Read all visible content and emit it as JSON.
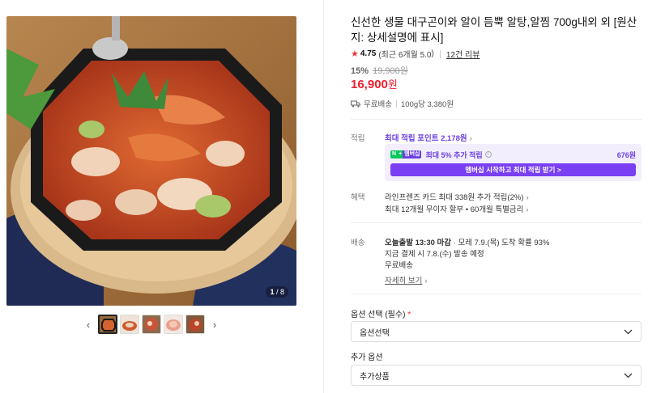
{
  "gallery": {
    "counter_current": "1",
    "counter_total": "/ 8",
    "prev_icon": "chevron-left-icon",
    "next_icon": "chevron-right-icon",
    "thumb_count": 5
  },
  "product": {
    "title": "신선한 생물 대구곤이와 알이 듬뿍 알탕,알찜 700g내외 외 [원산지: 상세설명에 표시]",
    "rating": "4.75",
    "rating_note": "(최근 6개월 5.0",
    "review_link": "12건 리뷰",
    "discount_pct": "15%",
    "original_price": "19,900원",
    "price": "16,900",
    "price_unit": "원",
    "shipping": "무료배송",
    "unit_price": "100g당 3,380원"
  },
  "points": {
    "label": "적립",
    "max_text": "최대 적립 포인트 2,178원",
    "membership_text": "최대 5% 추가 적립",
    "membership_amount": "676원",
    "cta": "멤버십 시작하고 최대 적립 받기 >"
  },
  "benefits": {
    "label": "혜택",
    "line1": "라인프렌즈 카드 최대 338원 추가 적립(2%)",
    "line2": "최대 12개월 무이자 할부 • 60개월 특별금리"
  },
  "delivery": {
    "label": "배송",
    "line1_bold": "오늘출발 13:30 마감",
    "line1_rest": "· 모레 7.9.(목) 도착 확률 93%",
    "line2": "지금 결제 시 7.8.(수) 발송 예정",
    "line3": "무료배송",
    "detail_link": "자세히 보기"
  },
  "options": {
    "required_label": "옵션 선택 (필수)",
    "required_mark": "*",
    "required_value": "옵션선택",
    "extra_label": "추가 옵션",
    "extra_value": "추가상품"
  },
  "colors": {
    "price_red": "#f01e2c",
    "point_purple": "#6b3fe0",
    "membership_btn": "#7a3ff2"
  }
}
